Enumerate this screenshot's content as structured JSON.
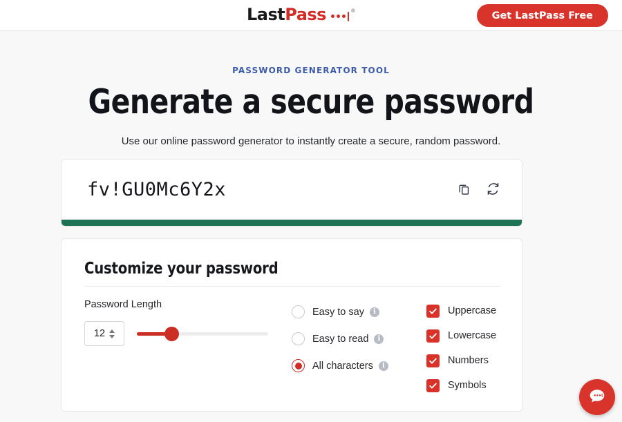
{
  "header": {
    "logo": {
      "part1": "Last",
      "part2": "Pass",
      "registered": "®"
    },
    "cta_label": "Get LastPass Free"
  },
  "hero": {
    "eyebrow": "PASSWORD GENERATOR TOOL",
    "headline": "Generate a secure password",
    "subhead": "Use our online password generator to instantly create a secure, random password."
  },
  "password_card": {
    "value": "fv!GU0Mc6Y2x",
    "copy_icon": "copy-icon",
    "refresh_icon": "refresh-icon",
    "strength_color": "#1d7353",
    "strength_percent": 100
  },
  "customize": {
    "title": "Customize your password",
    "length": {
      "label": "Password Length",
      "value": "12",
      "slider_percent": 27
    },
    "radios": [
      {
        "label": "Easy to say",
        "selected": false,
        "info": "i"
      },
      {
        "label": "Easy to read",
        "selected": false,
        "info": "i"
      },
      {
        "label": "All characters",
        "selected": true,
        "info": "i"
      }
    ],
    "checkboxes": [
      {
        "label": "Uppercase",
        "checked": true
      },
      {
        "label": "Lowercase",
        "checked": true
      },
      {
        "label": "Numbers",
        "checked": true
      },
      {
        "label": "Symbols",
        "checked": true
      }
    ]
  },
  "chat": {
    "icon": "chat-bubble-icon"
  },
  "colors": {
    "brand_red": "#d9342b",
    "accent_blue": "#3c5ba9",
    "strength_green": "#1d7353",
    "page_bg": "#f8f8f9"
  }
}
